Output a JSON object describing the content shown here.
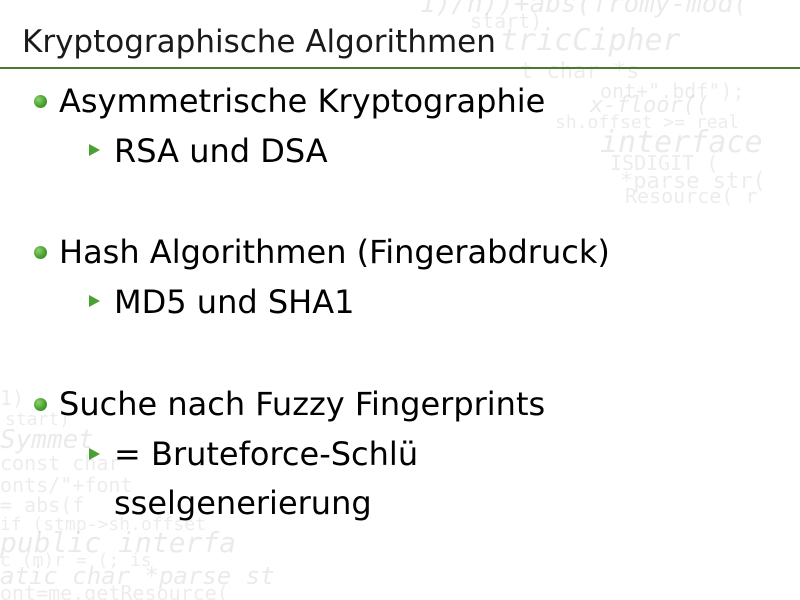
{
  "slide": {
    "title": "Kryptographische Algorithmen",
    "accent_color": "#4a7a2e",
    "bullet_color": "#4aa032",
    "sections": [
      {
        "text": "Asymmetrische Kryptographie",
        "subitems": [
          "RSA und DSA"
        ]
      },
      {
        "text": "Hash Algorithmen (Fingerabdruck)",
        "subitems": [
          "MD5 und SHA1"
        ]
      },
      {
        "text": "Suche nach Fuzzy Fingerprints",
        "subitems": [
          "= Bruteforce-Schlü",
          "sselgenerierung"
        ]
      }
    ],
    "bullet_icons": {
      "level1": "green-dot-icon",
      "level2": "green-triangle-icon"
    }
  }
}
